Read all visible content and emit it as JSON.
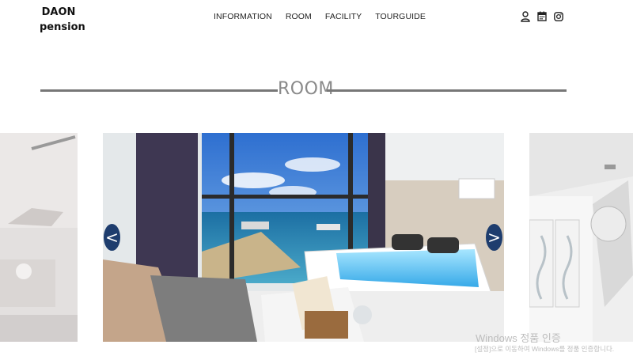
{
  "brand": {
    "line1": "DAON",
    "line2": "pension"
  },
  "nav": [
    {
      "label": "INFORMATION"
    },
    {
      "label": "ROOM"
    },
    {
      "label": "FACILITY"
    },
    {
      "label": "TOURGUIDE"
    }
  ],
  "header_icons": [
    "user-icon",
    "calendar-icon",
    "instagram-icon"
  ],
  "section": {
    "title": "ROOM"
  },
  "slider": {
    "prev_arrow": "<",
    "next_arrow": ">",
    "slides": [
      "room-interior-left",
      "room-jacuzzi-sea-view",
      "room-loft-right"
    ]
  },
  "watermark": {
    "title": "Windows 정품 인증",
    "subtitle": "[설정]으로 이동하여 Windows를 정품 인증합니다."
  },
  "colors": {
    "accent": "#1e3d6e",
    "title_gray": "#8a8a8a",
    "line_gray": "#777777"
  }
}
